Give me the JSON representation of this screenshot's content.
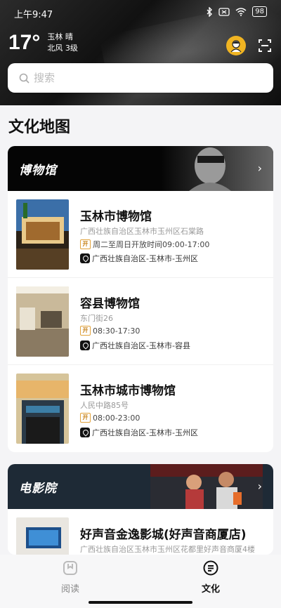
{
  "status": {
    "time": "上午9:47",
    "battery": "98"
  },
  "weather": {
    "temp": "17°",
    "city_cond": "玉林 晴",
    "wind": "北风 3级"
  },
  "search": {
    "placeholder": "搜索"
  },
  "section_title": "文化地图",
  "museum_category": {
    "title": "博物馆",
    "items": [
      {
        "name": "玉林市博物馆",
        "address": "广西壮族自治区玉林市玉州区石棠路",
        "open_badge": "开",
        "hours": "周二至周日开放时间09:00-17:00",
        "region": "广西壮族自治区-玉林市-玉州区"
      },
      {
        "name": "容县博物馆",
        "address": "东门街26",
        "open_badge": "开",
        "hours": "08:30-17:30",
        "region": "广西壮族自治区-玉林市-容县"
      },
      {
        "name": "玉林市城市博物馆",
        "address": "人民中路85号",
        "open_badge": "开",
        "hours": "08:00-23:00",
        "region": "广西壮族自治区-玉林市-玉州区"
      }
    ]
  },
  "cinema_category": {
    "title": "电影院",
    "items": [
      {
        "name": "好声音金逸影城(好声音商厦店)",
        "address": "广西壮族自治区玉林市玉州区花都里好声音商厦4楼"
      }
    ]
  },
  "tabs": [
    {
      "label": "阅读"
    },
    {
      "label": "文化"
    }
  ],
  "colors": {
    "accent_gold": "#f0b422",
    "badge_orange": "#e2a23a",
    "header_dark": "#111111"
  }
}
